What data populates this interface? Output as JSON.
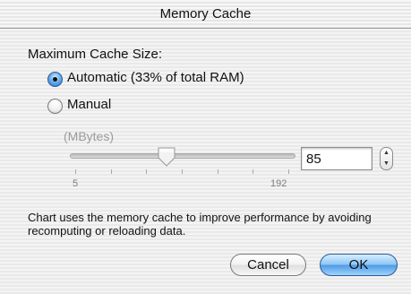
{
  "window": {
    "title": "Memory Cache"
  },
  "cache": {
    "section_label": "Maximum Cache Size:",
    "automatic_label": "Automatic (33% of total RAM)",
    "manual_label": "Manual",
    "selected": "automatic",
    "units_label": "(MBytes)",
    "slider": {
      "min": 5,
      "max": 192,
      "min_label": "5",
      "max_label": "192",
      "value": 85,
      "enabled": false
    },
    "value_field": "85"
  },
  "description": "Chart uses the memory cache to improve performance by avoiding recomputing or reloading data.",
  "buttons": {
    "cancel_label": "Cancel",
    "ok_label": "OK"
  },
  "colors": {
    "accent": "#4f9be6",
    "disabled_text": "#9b9b9b"
  },
  "icons": {
    "stepper": "stepper-arrows-icon",
    "slider_thumb": "slider-thumb-icon"
  }
}
